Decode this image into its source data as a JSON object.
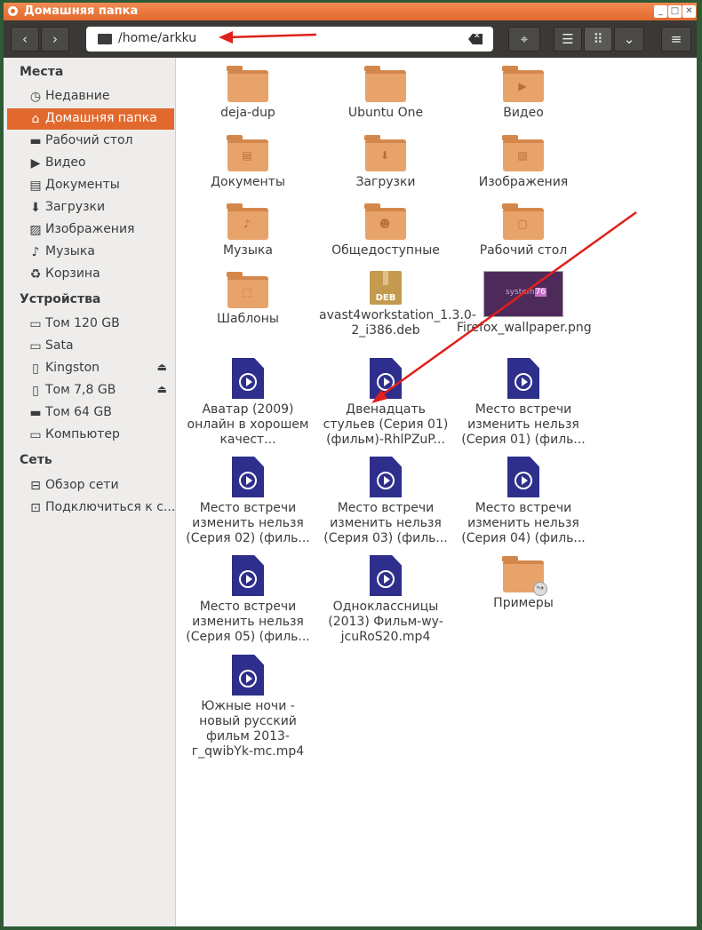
{
  "window": {
    "title": "Домашняя папка"
  },
  "toolbar": {
    "path": "/home/arkku"
  },
  "sidebar": {
    "places_heading": "Места",
    "places": [
      {
        "label": "Недавние",
        "icon": "clock-icon"
      },
      {
        "label": "Домашняя папка",
        "icon": "home-icon"
      },
      {
        "label": "Рабочий стол",
        "icon": "desktop-icon"
      },
      {
        "label": "Видео",
        "icon": "video-icon"
      },
      {
        "label": "Документы",
        "icon": "document-icon"
      },
      {
        "label": "Загрузки",
        "icon": "download-icon"
      },
      {
        "label": "Изображения",
        "icon": "image-icon"
      },
      {
        "label": "Музыка",
        "icon": "music-icon"
      },
      {
        "label": "Корзина",
        "icon": "trash-icon"
      }
    ],
    "devices_heading": "Устройства",
    "devices": [
      {
        "label": "Том 120 GB",
        "icon": "monitor-icon"
      },
      {
        "label": "Sata",
        "icon": "monitor-icon"
      },
      {
        "label": "Kingston",
        "icon": "usb-icon"
      },
      {
        "label": "Том 7,8 GB",
        "icon": "usb-icon"
      },
      {
        "label": "Том 64 GB",
        "icon": "drive-icon"
      },
      {
        "label": "Компьютер",
        "icon": "computer-icon"
      }
    ],
    "network_heading": "Сеть",
    "network": [
      {
        "label": "Обзор сети",
        "icon": "network-icon"
      },
      {
        "label": "Подключиться к с...",
        "icon": "connect-icon"
      }
    ]
  },
  "files": [
    {
      "label": "deja-dup",
      "type": "folder"
    },
    {
      "label": "Ubuntu One",
      "type": "folder"
    },
    {
      "label": "Видео",
      "type": "folder",
      "emblem": "▶"
    },
    {
      "label": "Документы",
      "type": "folder",
      "emblem": "▤"
    },
    {
      "label": "Загрузки",
      "type": "folder",
      "emblem": "⬇"
    },
    {
      "label": "Изображения",
      "type": "folder",
      "emblem": "▨"
    },
    {
      "label": "Музыка",
      "type": "folder",
      "emblem": "♪"
    },
    {
      "label": "Общедоступные",
      "type": "folder",
      "emblem": "☻"
    },
    {
      "label": "Рабочий стол",
      "type": "folder",
      "emblem": "▢"
    },
    {
      "label": "Шаблоны",
      "type": "folder",
      "emblem": "⬚"
    },
    {
      "label": "avast4workstation_1.3.0-2_i386.deb",
      "type": "deb",
      "badge": "DEB"
    },
    {
      "label": "Firefox_wallpaper.png",
      "type": "image",
      "thumb_text": "system",
      "thumb_badge": "76"
    },
    {
      "label": "Аватар (2009) онлайн в хорошем качест...",
      "type": "video"
    },
    {
      "label": "Двенадцать стульев (Серия 01) (фильм)-RhlPZuP...",
      "type": "video"
    },
    {
      "label": "Место встречи изменить нельзя (Серия 01) (филь...",
      "type": "video"
    },
    {
      "label": "Место встречи изменить нельзя (Серия 02) (филь...",
      "type": "video"
    },
    {
      "label": "Место встречи изменить нельзя (Серия 03) (филь...",
      "type": "video"
    },
    {
      "label": "Место встречи изменить нельзя (Серия 04) (филь...",
      "type": "video"
    },
    {
      "label": "Место встречи изменить нельзя (Серия 05) (филь...",
      "type": "video"
    },
    {
      "label": "Одноклассницы (2013) Фильм-wy-jcuRoS20.mp4",
      "type": "video"
    },
    {
      "label": "Примеры",
      "type": "folder-link"
    },
    {
      "label": "Южные ночи - новый русский фильм 2013-г_qwibYk-mc.mp4",
      "type": "video"
    }
  ],
  "colors": {
    "accent": "#e2692e",
    "folder": "#e8a36b",
    "video": "#2e2e8c",
    "annotation_arrow": "#e0201a"
  }
}
